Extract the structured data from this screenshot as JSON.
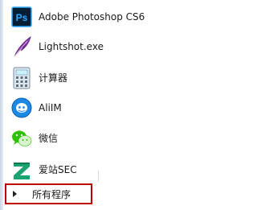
{
  "start_menu": {
    "programs": [
      {
        "label": "Adobe Photoshop CS6",
        "icon": "photoshop-icon",
        "icon_text": "Ps"
      },
      {
        "label": "Lightshot.exe",
        "icon": "feather-icon"
      },
      {
        "label": "计算器",
        "icon": "calculator-icon"
      },
      {
        "label": "AliIM",
        "icon": "aliim-icon"
      },
      {
        "label": "微信",
        "icon": "wechat-icon"
      },
      {
        "label": "爱站SEC",
        "icon": "aizhan-icon"
      }
    ],
    "all_programs_label": "所有程序"
  },
  "colors": {
    "highlight_border": "#c00000",
    "photoshop_bg": "#001e36",
    "photoshop_text": "#31a8ff",
    "wechat_green": "#2dc100",
    "aliim_blue": "#1e88e5"
  }
}
